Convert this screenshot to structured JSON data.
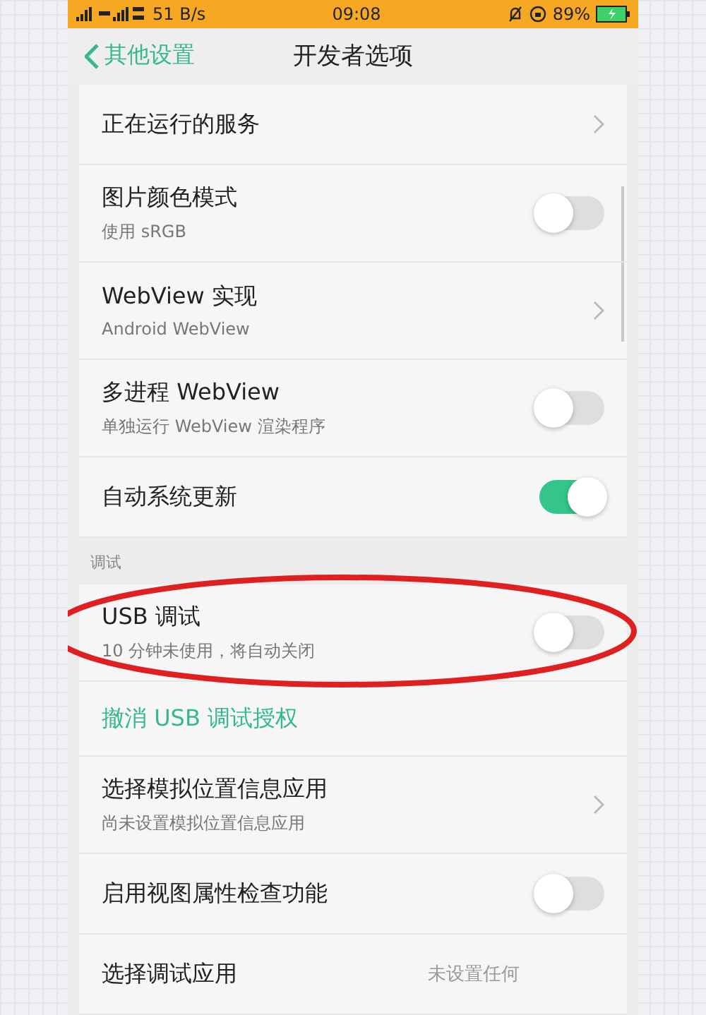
{
  "status_bar": {
    "speed": "51 B/s",
    "time": "09:08",
    "battery": "89%"
  },
  "nav": {
    "back_label": "其他设置",
    "title": "开发者选项"
  },
  "sections": [
    {
      "items": [
        {
          "kind": "link",
          "title": "正在运行的服务"
        },
        {
          "kind": "toggle",
          "title": "图片颜色模式",
          "subtitle": "使用 sRGB",
          "on": false
        },
        {
          "kind": "link",
          "title": "WebView 实现",
          "subtitle": "Android WebView"
        },
        {
          "kind": "toggle",
          "title": "多进程 WebView",
          "subtitle": "单独运行 WebView 渲染程序",
          "on": false
        },
        {
          "kind": "toggle",
          "title": "自动系统更新",
          "on": true
        }
      ]
    },
    {
      "header": "调试",
      "items": [
        {
          "kind": "toggle",
          "title": "USB 调试",
          "subtitle": "10 分钟未使用，将自动关闭",
          "on": false,
          "highlighted": true
        },
        {
          "kind": "action",
          "title": "撤消 USB 调试授权"
        },
        {
          "kind": "link",
          "title": "选择模拟位置信息应用",
          "subtitle": "尚未设置模拟位置信息应用"
        },
        {
          "kind": "toggle",
          "title": "启用视图属性检查功能",
          "on": false
        },
        {
          "kind": "value",
          "title": "选择调试应用",
          "value": "未设置任何"
        }
      ]
    }
  ]
}
